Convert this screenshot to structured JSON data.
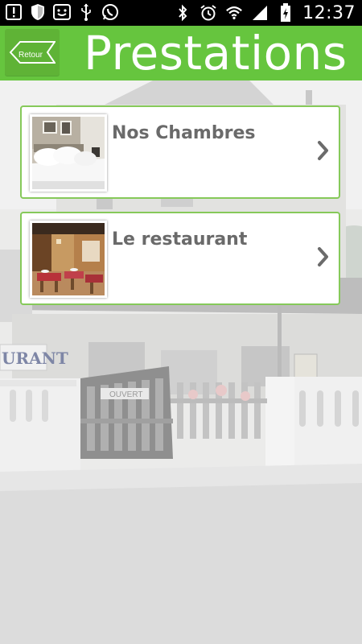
{
  "status_bar": {
    "time": "12:37",
    "left_icons": [
      "alert-icon",
      "shield-icon",
      "emoji-icon",
      "usb-icon",
      "whatsapp-icon"
    ],
    "right_icons": [
      "bluetooth-icon",
      "alarm-icon",
      "wifi-icon",
      "signal-icon",
      "battery-charging-icon"
    ]
  },
  "header": {
    "title": "Prestations",
    "back_label": "Retour",
    "bar_color": "#66c53e"
  },
  "items": [
    {
      "label": "Nos Chambres",
      "thumb": "bedroom-photo"
    },
    {
      "label": "Le restaurant",
      "thumb": "restaurant-photo"
    }
  ],
  "background": {
    "sign_text": "URANT",
    "gate_sign_text": "OUVERT"
  }
}
